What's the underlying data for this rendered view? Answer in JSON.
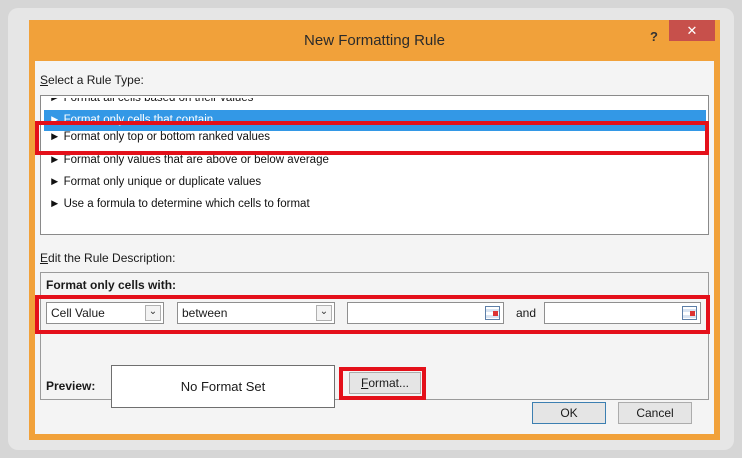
{
  "dialog": {
    "title": "New Formatting Rule",
    "help_label": "?",
    "close_label": "✕"
  },
  "rule_type": {
    "label_prefix": "S",
    "label_rest": "elect a Rule Type:",
    "items": [
      "► Format all cells based on their values",
      "► Format only cells that contain",
      "► Format only top or bottom ranked values",
      "► Format only values that are above or below average",
      "► Format only unique or duplicate values",
      "► Use a formula to determine which cells to format"
    ],
    "selected_index": 1
  },
  "description": {
    "label_prefix": "E",
    "label_rest": "dit the Rule Description:",
    "heading": "Format only cells with:",
    "condition_select": "Cell Value",
    "operator_select": "between",
    "value1": "",
    "and_label": "and",
    "value2": ""
  },
  "preview": {
    "label": "Preview:",
    "text": "No Format Set",
    "format_button_prefix": "F",
    "format_button_rest": "ormat..."
  },
  "footer": {
    "ok_label": "OK",
    "cancel_label": "Cancel"
  },
  "colors": {
    "highlight": "#e4101a",
    "selection": "#3398e6",
    "title_bar": "#f1a13a",
    "close_button": "#c7504b"
  }
}
